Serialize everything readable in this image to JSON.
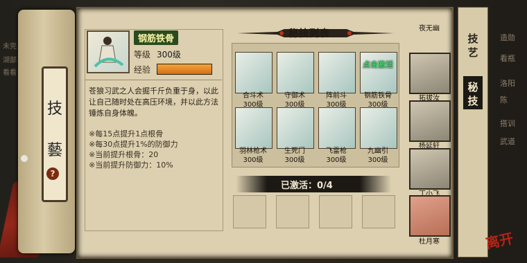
{
  "background": {
    "left_texts": [
      "未完",
      "湖部",
      "看看"
    ],
    "right_texts": [
      "造勋",
      "看瓶",
      "洛阳",
      "陈",
      "搭训",
      "武道"
    ]
  },
  "left_scroll": {
    "chars": [
      "技",
      "藝"
    ],
    "help": "?"
  },
  "panel_title": "秘技列表",
  "selected_skill": {
    "name": "钢筋铁骨",
    "level_label": "等级",
    "level_value": "300级",
    "exp_label": "经验",
    "exp_fraction": 1.0,
    "description": "苍狼习武之人会掘千斤负重于身，以此让自己随时处在高压环境，并以此方法锤炼自身体魄。",
    "bullets": [
      "※每15点提升1点根骨",
      "※每30点提升1%的防御力",
      "※当前提升根骨：20",
      "※当前提升防御力：10%"
    ]
  },
  "skills": [
    {
      "name": "合斗术",
      "level": "300级"
    },
    {
      "name": "守御术",
      "level": "300级"
    },
    {
      "name": "阵前斗",
      "level": "300级"
    },
    {
      "name": "钢筋铁骨",
      "level": "300级",
      "tag": "点击激活"
    },
    {
      "name": "羽林枪术",
      "level": "300级"
    },
    {
      "name": "生死门",
      "level": "300级"
    },
    {
      "name": "飞雷枪",
      "level": "300级"
    },
    {
      "name": "九幽引",
      "level": "300级"
    }
  ],
  "activated": "已激活：0/4",
  "tabs": [
    "技艺",
    "秘技"
  ],
  "heroes": [
    "夜无幽",
    "拓拔汝",
    "杨延轩",
    "丁小飞",
    "杜月寒"
  ],
  "exit_label": "离开"
}
